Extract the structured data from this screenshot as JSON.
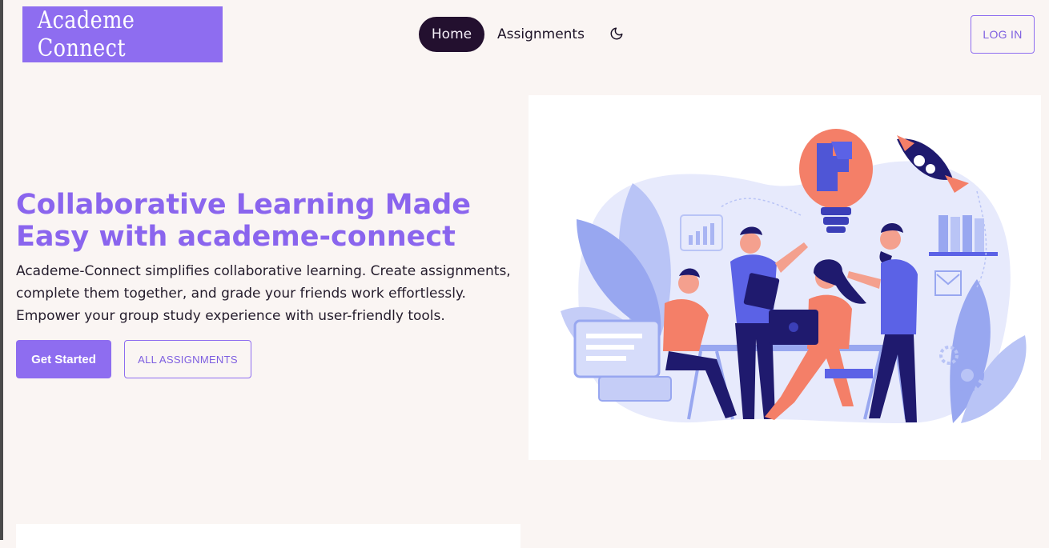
{
  "app": {
    "logo_text": "Academe Connect"
  },
  "nav": {
    "home_label": "Home",
    "assignments_label": "Assignments",
    "theme_icon": "moon-icon"
  },
  "header": {
    "login_label": "LOG IN"
  },
  "hero": {
    "title": "Collaborative Learning Made Easy with academe-connect",
    "description": "Academe-Connect simplifies collaborative learning. Create assignments, complete them together, and grade your friends work effortlessly. Empower your group study experience with user-friendly tools.",
    "get_started_label": "Get Started",
    "all_assignments_label": "ALL ASSIGNMENTS"
  },
  "colors": {
    "brand": "#8e6df0",
    "nav_active_bg": "#23102f",
    "page_bg": "#faf5f3",
    "accent_coral": "#f47f68",
    "accent_navy": "#1f1a6e",
    "accent_blue": "#5b62e6"
  }
}
